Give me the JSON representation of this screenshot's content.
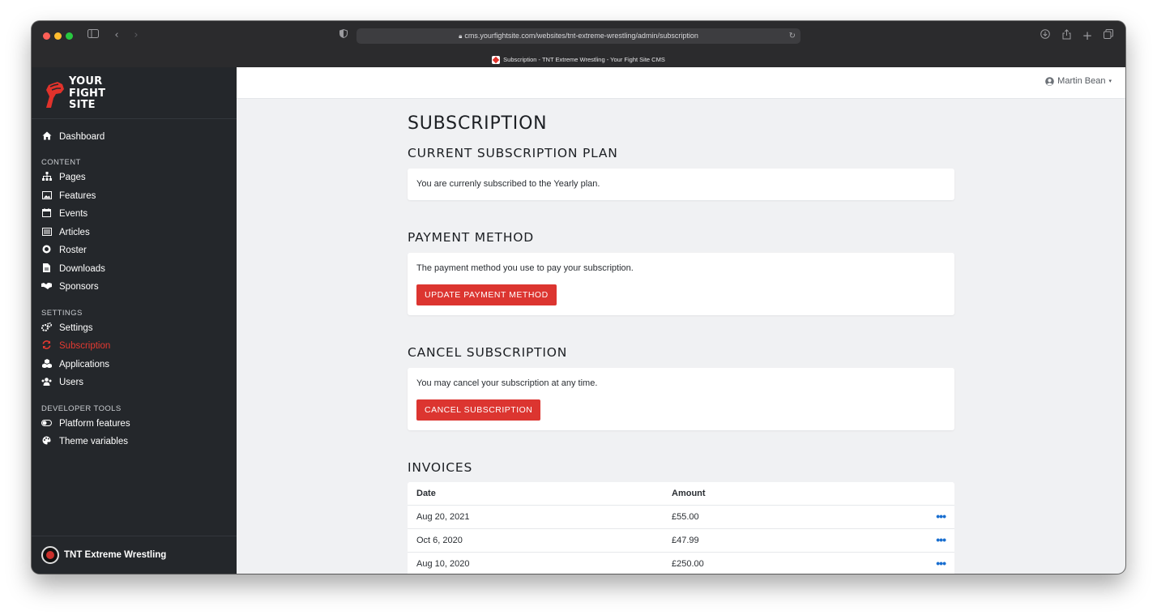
{
  "browser": {
    "url": "cms.yourfightsite.com/websites/tnt-extreme-wrestling/admin/subscription",
    "tab_title": "Subscription - TNT Extreme Wrestling - Your Fight Site CMS"
  },
  "brand": {
    "line1": "YOUR",
    "line2": "FIGHT",
    "line3": "SITE"
  },
  "sidebar": {
    "dashboard": "Dashboard",
    "content_heading": "CONTENT",
    "content_items": [
      "Pages",
      "Features",
      "Events",
      "Articles",
      "Roster",
      "Downloads",
      "Sponsors"
    ],
    "settings_heading": "SETTINGS",
    "settings_items": [
      "Settings",
      "Subscription",
      "Applications",
      "Users"
    ],
    "dev_heading": "DEVELOPER TOOLS",
    "dev_items": [
      "Platform features",
      "Theme variables"
    ],
    "active_item": "Subscription",
    "footer_org": "TNT Extreme Wrestling"
  },
  "topbar": {
    "user_name": "Martin Bean"
  },
  "page": {
    "title": "SUBSCRIPTION",
    "current_plan": {
      "heading": "CURRENT SUBSCRIPTION PLAN",
      "text": "You are currenly subscribed to the Yearly plan."
    },
    "payment_method": {
      "heading": "PAYMENT METHOD",
      "text": "The payment method you use to pay your subscription.",
      "button": "UPDATE PAYMENT METHOD"
    },
    "cancel": {
      "heading": "CANCEL SUBSCRIPTION",
      "text": "You may cancel your subscription at any time.",
      "button": "CANCEL SUBSCRIPTION"
    },
    "invoices": {
      "heading": "INVOICES",
      "columns": [
        "Date",
        "Amount"
      ],
      "rows": [
        {
          "date": "Aug 20, 2021",
          "amount": "£55.00"
        },
        {
          "date": "Oct 6, 2020",
          "amount": "£47.99"
        },
        {
          "date": "Aug 10, 2020",
          "amount": "£250.00"
        }
      ],
      "more_glyph": "•••"
    }
  },
  "colors": {
    "accent": "#dc3530",
    "sidebar_bg": "#24272b",
    "link": "#1a6fd0",
    "page_bg": "#f0f1f3"
  }
}
